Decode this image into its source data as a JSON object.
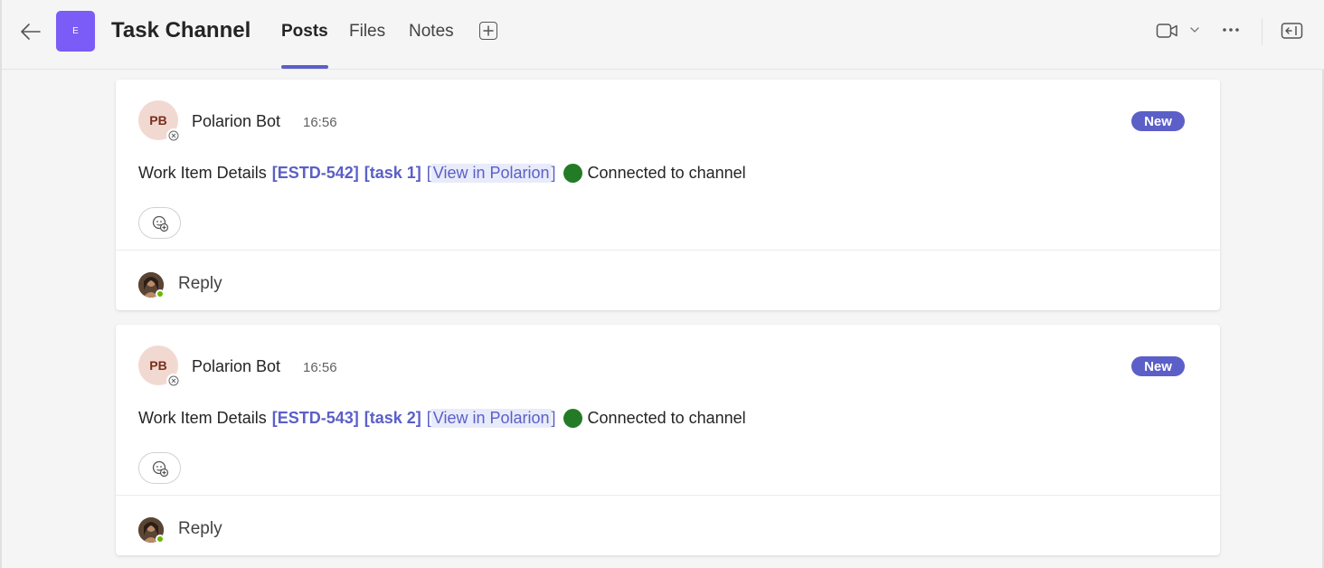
{
  "header": {
    "team_initial": "E",
    "channel_title": "Task Channel",
    "tabs": [
      {
        "label": "Posts",
        "active": true
      },
      {
        "label": "Files",
        "active": false
      },
      {
        "label": "Notes",
        "active": false
      }
    ],
    "icons": [
      "back-arrow-icon",
      "add-tab-icon",
      "video-call-icon",
      "chevron-down-icon",
      "more-options-icon",
      "open-panel-icon"
    ]
  },
  "posts": [
    {
      "avatar_initials": "PB",
      "sender": "Polarion Bot",
      "time": "16:56",
      "badge": "New",
      "message": {
        "prefix": "Work Item Details",
        "item_id": "[ESTD-542]",
        "item_name": "[task 1]",
        "open_bracket": "[",
        "link_text": "View in Polarion",
        "close_bracket": "]",
        "status": "Connected to channel"
      },
      "reply_label": "Reply"
    },
    {
      "avatar_initials": "PB",
      "sender": "Polarion Bot",
      "time": "16:56",
      "badge": "New",
      "message": {
        "prefix": "Work Item Details",
        "item_id": "[ESTD-543]",
        "item_name": "[task 2]",
        "open_bracket": "[",
        "link_text": "View in Polarion",
        "close_bracket": "]",
        "status": "Connected to channel"
      },
      "reply_label": "Reply"
    }
  ],
  "colors": {
    "accent": "#5b5fc7",
    "team_avatar": "#7b5cf6",
    "status_green": "#237b26",
    "bot_avatar_bg": "#f1d9d2"
  }
}
